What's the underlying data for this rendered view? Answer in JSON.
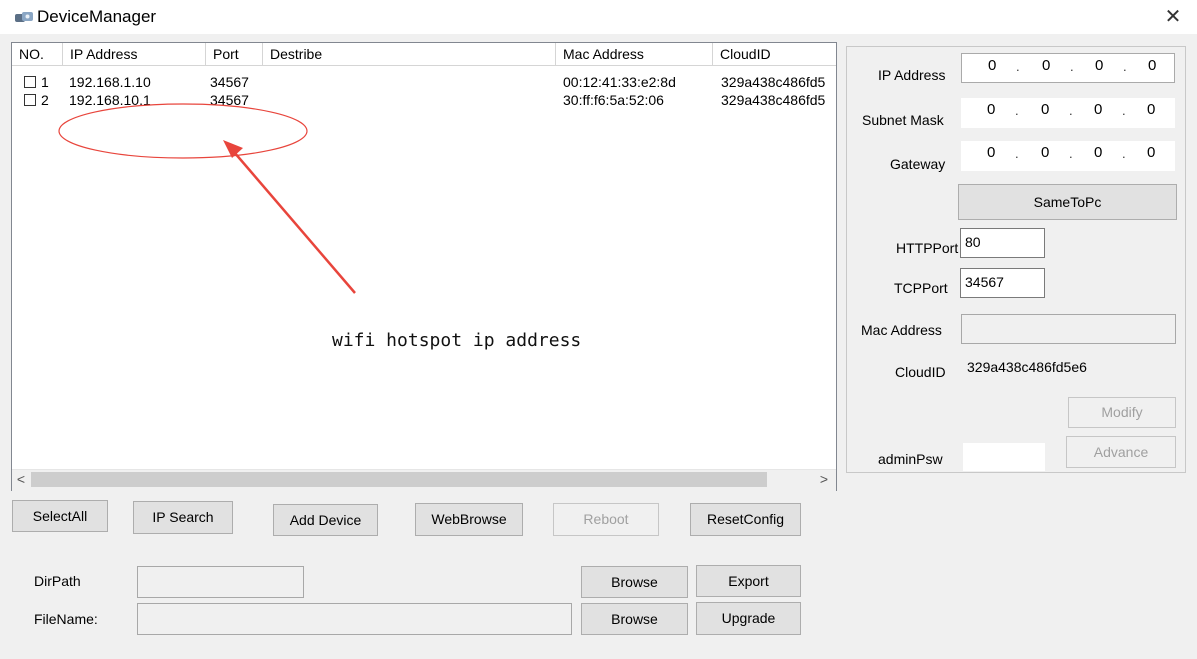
{
  "window": {
    "title": "DeviceManager",
    "close_glyph": "✕",
    "icon": "device-manager-icon"
  },
  "device_table": {
    "columns": [
      "NO.",
      "IP Address",
      "Port",
      "Destribe",
      "Mac Address",
      "CloudID"
    ],
    "rows": [
      {
        "no": "1",
        "ip": "192.168.1.10",
        "port": "34567",
        "describe": "",
        "mac": "00:12:41:33:e2:8d",
        "cloud_id": "329a438c486fd5"
      },
      {
        "no": "2",
        "ip": "192.168.10.1",
        "port": "34567",
        "describe": "",
        "mac": "30:ff:f6:5a:52:06",
        "cloud_id": "329a438c486fd5"
      }
    ],
    "scroll_left": "<",
    "scroll_right": ">"
  },
  "annotation": {
    "text": "wifi hotspot ip address",
    "color": "#e8453c"
  },
  "buttons": {
    "select_all": "SelectAll",
    "ip_search": "IP Search",
    "add_device": "Add Device",
    "web_browse": "WebBrowse",
    "reboot": "Reboot",
    "reset_config": "ResetConfig",
    "browse_dir": "Browse",
    "export": "Export",
    "browse_file": "Browse",
    "upgrade": "Upgrade"
  },
  "file_section": {
    "dir_path_label": "DirPath",
    "dir_path_value": "",
    "file_name_label": "FileName:",
    "file_name_value": ""
  },
  "config_panel": {
    "ip_address_label": "IP Address",
    "ip_address": [
      "0",
      "0",
      "0",
      "0"
    ],
    "subnet_mask_label": "Subnet Mask",
    "subnet_mask": [
      "0",
      "0",
      "0",
      "0"
    ],
    "gateway_label": "Gateway",
    "gateway": [
      "0",
      "0",
      "0",
      "0"
    ],
    "same_to_pc": "SameToPc",
    "http_port_label": "HTTPPort",
    "http_port": "80",
    "tcp_port_label": "TCPPort",
    "tcp_port": "34567",
    "mac_address_label": "Mac Address",
    "mac_address": "",
    "cloud_id_label": "CloudID",
    "cloud_id": "329a438c486fd5e6",
    "modify": "Modify",
    "advance": "Advance",
    "admin_psw_label": "adminPsw",
    "admin_psw": ""
  }
}
